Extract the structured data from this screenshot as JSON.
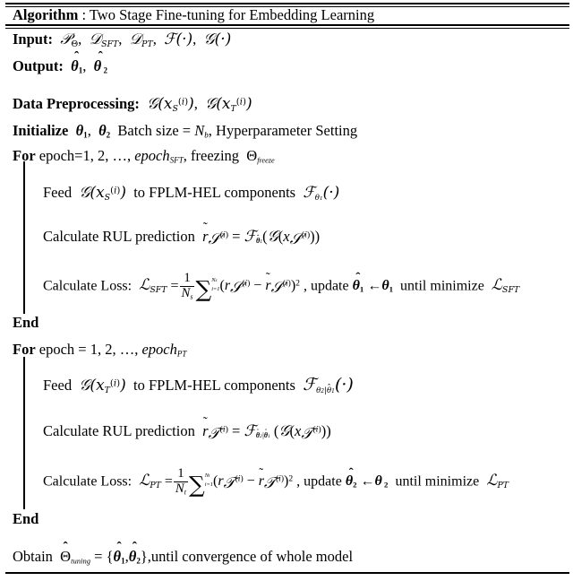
{
  "document": {
    "type": "algorithm-pseudocode",
    "title_label": "Algorithm",
    "title_sep": ":",
    "title_text": "Two Stage Fine-tuning for Embedding Learning"
  },
  "header": {
    "input_label": "Input:",
    "input_items": [
      "P_Θ",
      "D_SFT",
      "D_PT",
      "F(·)",
      "G(·)"
    ],
    "output_label": "Output:",
    "output_items": [
      "θ̂1",
      "θ̂2"
    ]
  },
  "preprocessing": {
    "label": "Data Preprocessing:",
    "items": [
      "G(x_S^(i))",
      "G(x_T^(i))"
    ]
  },
  "initialize": {
    "label": "Initialize",
    "params": [
      "θ1",
      "θ2"
    ],
    "text": "Batch size =",
    "batch_symbol": "N_b",
    "trailing": ", Hyperparameter Setting"
  },
  "stage1": {
    "for_label": "For",
    "for_text": "epoch=1, 2, …,",
    "for_epoch": "epoch_SFT",
    "for_tail": ", freezing",
    "freeze_symbol": "Θ_freeze",
    "feed_label": "Feed",
    "feed_arg": "G(x_S^(i))",
    "feed_mid": "to FPLM-HEL components",
    "feed_fn": "F_θ1(·)",
    "rul_label": "Calculate RUL prediction",
    "rul_eq": "r̃_S^(i) = F_θ̂1(G(x_S^(i)))",
    "loss_label": "Calculate Loss:",
    "loss_symbol": "L_SFT",
    "loss_frac_num": "1",
    "loss_frac_den": "N_s",
    "loss_sum_top": "N_s",
    "loss_sum_bot": "i=1",
    "loss_body": "(r_S^(i) − r̃_S^(i))²",
    "update_label": ", update",
    "update_eq": "θ̂1 ← θ1",
    "until_label": "until minimize",
    "until_symbol": "L_SFT",
    "end_label": "End"
  },
  "stage2": {
    "for_label": "For",
    "for_text": "epoch = 1, 2, …,",
    "for_epoch": "epoch_PT",
    "feed_label": "Feed",
    "feed_arg": "G(x_T^(i))",
    "feed_mid": "to FPLM-HEL components",
    "feed_fn": "F_θ2|θ̂1(·)",
    "rul_label": "Calculate RUL prediction",
    "rul_eq": "r̃_T^(i) = F_θ̂2|θ̂1(G(x_T^(i)))",
    "loss_label": "Calculate Loss:",
    "loss_symbol": "L_PT",
    "loss_frac_num": "1",
    "loss_frac_den": "N_t",
    "loss_sum_top": "N_t",
    "loss_sum_bot": "i=1",
    "loss_body": "(r_T^(i) − r̃_T^(i))²",
    "update_label": ", update",
    "update_eq": "θ̂2 ← θ2",
    "until_label": "until minimize",
    "until_symbol": "L_PT",
    "end_label": "End"
  },
  "footer": {
    "obtain_label": "Obtain",
    "obtain_eq": "Θ̂_tuning = {θ̂1, θ̂2}",
    "obtain_tail": ",until convergence of whole model"
  },
  "glyphs": {
    "script_P": "𝒫",
    "script_D": "𝒟",
    "script_F": "ℱ",
    "script_G": "𝒢",
    "script_L": "ℒ",
    "script_S": "𝒮",
    "script_T": "𝒯",
    "theta": "θ",
    "Theta": "Θ",
    "hat": "ˆ",
    "tilde": "˜",
    "arrow_left": "←",
    "sigma": "∑",
    "dot": "·",
    "ellipsis": "…",
    "minus": "−"
  }
}
